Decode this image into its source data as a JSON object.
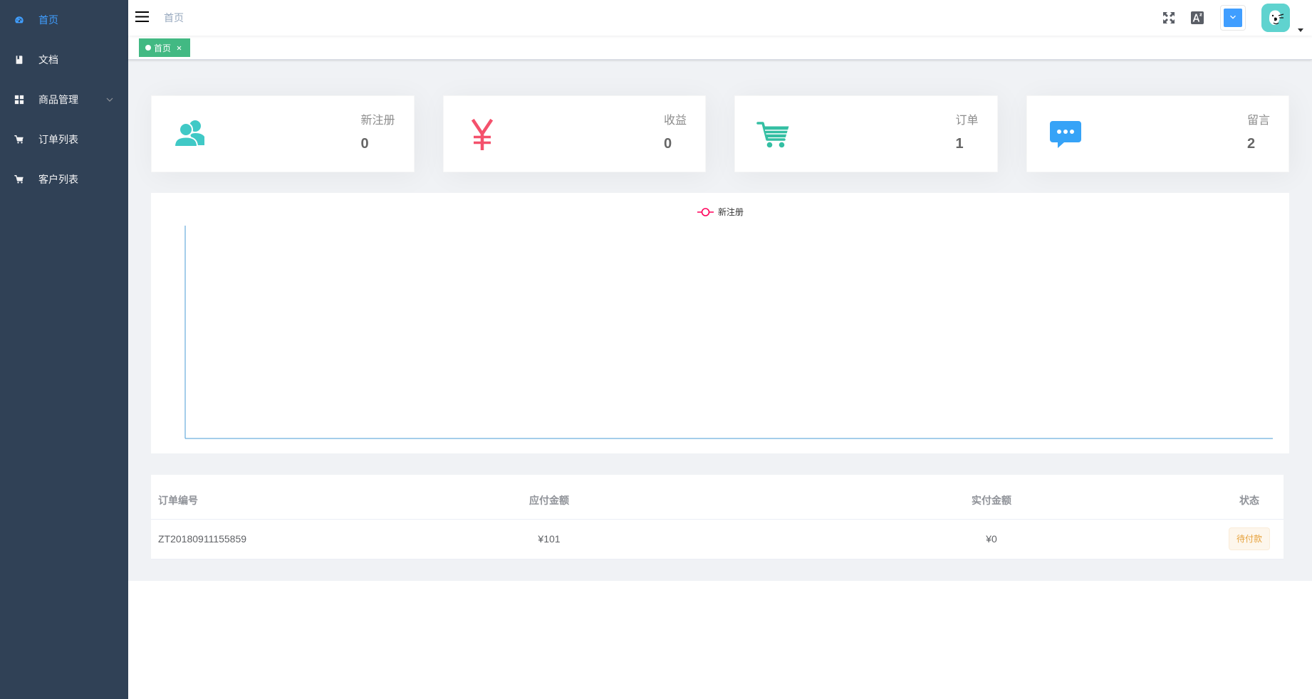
{
  "sidebar": {
    "items": [
      {
        "label": "首页",
        "icon": "dashboard-icon",
        "active": true
      },
      {
        "label": "文档",
        "icon": "documentation-icon",
        "active": false
      },
      {
        "label": "商品管理",
        "icon": "grid-icon",
        "active": false,
        "submenu_indicator": "chevron-down-icon"
      },
      {
        "label": "订单列表",
        "icon": "cart-icon",
        "active": false
      },
      {
        "label": "客户列表",
        "icon": "cart-icon",
        "active": false
      }
    ]
  },
  "navbar": {
    "toggle_icon": "hamburger-icon",
    "breadcrumb": [
      "首页"
    ],
    "actions": {
      "fullscreen_icon": "fullscreen-icon",
      "size_icon": "size-icon",
      "theme_color": "#409EFF",
      "theme_dropdown_icon": "chevron-down-icon",
      "avatar": "avatar-image",
      "avatar_caret": "caret-down-icon"
    }
  },
  "tags_view": {
    "tags": [
      {
        "label": "首页",
        "active": true,
        "close_icon": "close-icon"
      }
    ]
  },
  "dashboard": {
    "panels": [
      {
        "label": "新注册",
        "value": 0,
        "icon": "people-icon",
        "color": "#40c9c6"
      },
      {
        "label": "收益",
        "value": 0,
        "icon": "money-icon",
        "color": "#f4516c"
      },
      {
        "label": "订单",
        "value": 1,
        "icon": "shopping-cart-icon",
        "color": "#34bfa3"
      },
      {
        "label": "留言",
        "value": 2,
        "icon": "message-icon",
        "color": "#36a3f7"
      }
    ]
  },
  "chart_data": {
    "type": "line",
    "categories": [],
    "series": [
      {
        "name": "新注册",
        "values": [],
        "color": "#FF005A"
      }
    ],
    "legend": "top-center",
    "grid": false,
    "axis_color": "#4a9bd6"
  },
  "orders_table": {
    "columns": [
      "订单编号",
      "应付金额",
      "实付金额",
      "状态"
    ],
    "rows": [
      {
        "order_no": "ZT20180911155859",
        "amount_payable": "¥101",
        "amount_paid": "¥0",
        "status": "待付款",
        "status_color": "#e6a23c"
      }
    ]
  },
  "colors": {
    "sidebar_background": "#304156",
    "active_menu": "#409EFF",
    "tag_active": "#42b983",
    "page_background": "#f0f2f5"
  }
}
